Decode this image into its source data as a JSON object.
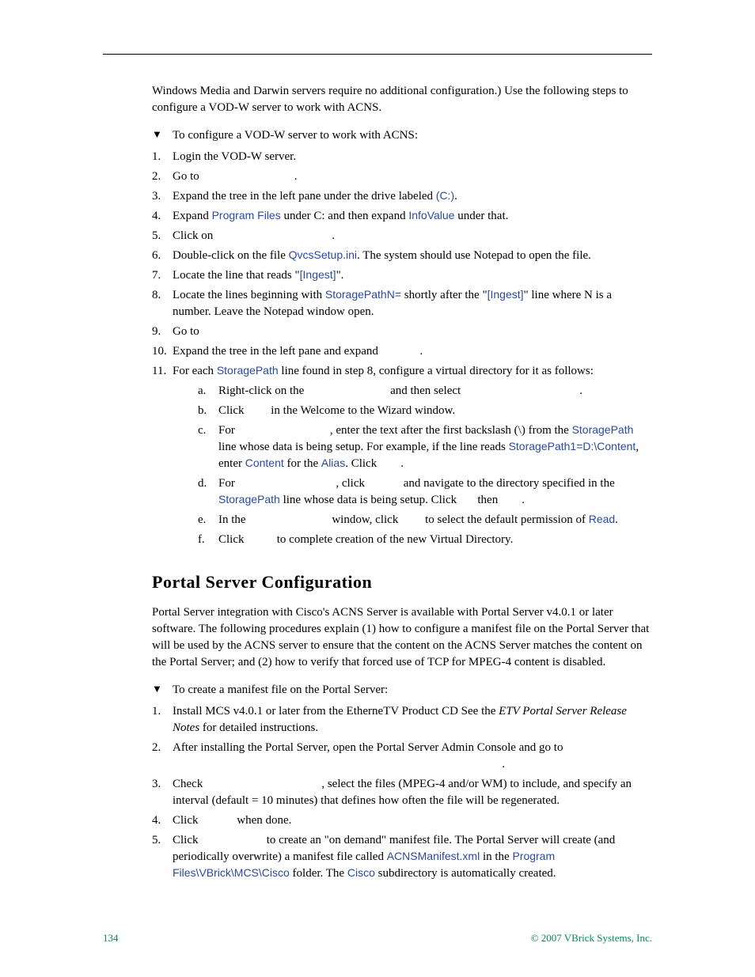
{
  "intro_p": "Windows Media and Darwin servers require no additional configuration.) Use the following steps to configure a VOD-W server to work with ACNS.",
  "proc1_title": "To configure a VOD-W server to work with ACNS:",
  "s1": "Login the VOD-W server.",
  "s2_a": "Go to ",
  "s2_b": ".",
  "s3_a": "Expand the tree in the left pane under the drive labeled ",
  "s3_b": "(C:)",
  "s3_c": ".",
  "s4_a": "Expand ",
  "s4_b": "Program Files",
  "s4_c": " under C: and then expand ",
  "s4_d": "InfoValue",
  "s4_e": " under that.",
  "s5_a": "Click on ",
  "s5_b": ".",
  "s6_a": "Double-click on the file ",
  "s6_b": "QvcsSetup.ini",
  "s6_c": ". The system should use Notepad to open the file.",
  "s7_a": "Locate the line that reads \"",
  "s7_b": "[Ingest]",
  "s7_c": "\".",
  "s8_a": "Locate the lines beginning with ",
  "s8_b": "StoragePathN=",
  "s8_c": " shortly after the \"",
  "s8_d": "[Ingest]",
  "s8_e": "\" line where N is a number. Leave the Notepad window open.",
  "s9_a": "Go to ",
  "s10_a": "Expand the tree in the left pane and expand ",
  "s10_b": ".",
  "s11_a": "For each ",
  "s11_b": "StoragePath",
  "s11_c": " line found in step 8, configure a virtual directory for it as follows:",
  "s11a_a": "Right-click on the ",
  "s11a_b": " and then select ",
  "s11a_c": ".",
  "s11b_a": "Click ",
  "s11b_b": " in the Welcome to the Wizard window.",
  "s11c_a": "For ",
  "s11c_b": ", enter the text after the first backslash (\\) from the ",
  "s11c_c": "StoragePath",
  "s11c_d": " line whose data is being setup. For example, if the line reads ",
  "s11c_e": "StoragePath1=D:\\Content",
  "s11c_f": ", enter ",
  "s11c_g": "Content",
  "s11c_h": " for the ",
  "s11c_i": "Alias",
  "s11c_j": ". Click ",
  "s11c_k": ".",
  "s11d_a": "For ",
  "s11d_b": ", click ",
  "s11d_c": " and navigate to the directory specified in the ",
  "s11d_d": "StoragePath",
  "s11d_e": " line whose data is being setup. Click ",
  "s11d_f": " then ",
  "s11d_g": ".",
  "s11e_a": "In the ",
  "s11e_b": " window, click ",
  "s11e_c": " to select the default permission of ",
  "s11e_d": "Read",
  "s11e_e": ".",
  "s11f_a": "Click ",
  "s11f_b": " to complete creation of the new Virtual Directory.",
  "section2": "Portal Server Configuration",
  "p2": "Portal Server integration with Cisco's ACNS Server is available with Portal Server v4.0.1 or later software. The following procedures explain (1) how to configure a manifest file on the Portal Server that will be used by the ACNS server to ensure that the content on the ACNS Server matches the content on the Portal Server; and (2) how to verify that forced use of TCP for MPEG-4 content is disabled.",
  "proc2_title": "To create a manifest file on the Portal Server:",
  "t1_a": "Install MCS v4.0.1 or later from the EtherneTV Product CD See the ",
  "t1_b": "ETV Portal Server Release Notes",
  "t1_c": " for detailed instructions.",
  "t2_a": "After installing the Portal Server, open the Portal Server Admin Console and go to ",
  "t2_b": ".",
  "t3_a": "Check ",
  "t3_b": ", select the files (MPEG-4 and/or WM) to include, and specify an interval (default = 10 minutes) that defines how often the file will be regenerated.",
  "t4_a": "Click ",
  "t4_b": " when done.",
  "t5_a": "Click ",
  "t5_b": " to create an \"on demand\" manifest file. The Portal Server will create (and periodically overwrite) a manifest file called ",
  "t5_c": "ACNSManifest.xml",
  "t5_d": " in the ",
  "t5_e": "Program Files\\VBrick\\MCS\\Cisco",
  "t5_f": " folder. The ",
  "t5_g": "Cisco",
  "t5_h": " subdirectory is automatically created.",
  "footer_page": "134",
  "footer_copy": "© 2007 VBrick Systems, Inc."
}
